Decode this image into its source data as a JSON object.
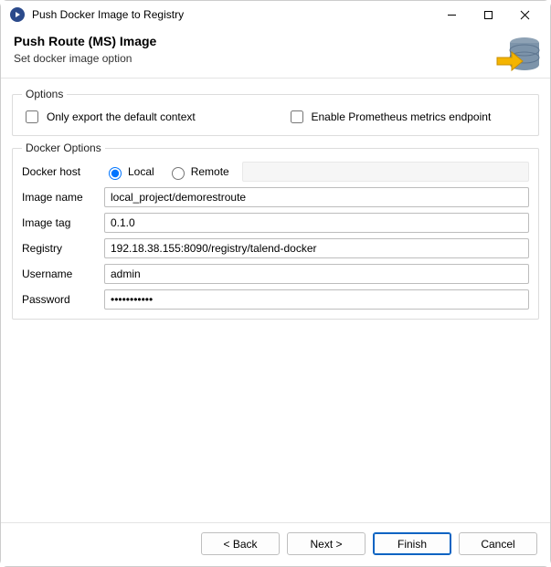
{
  "window": {
    "title": "Push Docker Image to Registry"
  },
  "header": {
    "title": "Push Route (MS) Image",
    "subtitle": "Set docker image option"
  },
  "options": {
    "legend": "Options",
    "only_export_default_context": {
      "label": "Only export the default context",
      "checked": false
    },
    "enable_prometheus": {
      "label": "Enable Prometheus metrics endpoint",
      "checked": false
    }
  },
  "docker": {
    "legend": "Docker Options",
    "host": {
      "label": "Docker host",
      "local_label": "Local",
      "remote_label": "Remote",
      "selected": "local"
    },
    "image_name": {
      "label": "Image name",
      "value": "local_project/demorestroute"
    },
    "image_tag": {
      "label": "Image tag",
      "value": "0.1.0"
    },
    "registry": {
      "label": "Registry",
      "value": "192.18.38.155:8090/registry/talend-docker"
    },
    "username": {
      "label": "Username",
      "value": "admin"
    },
    "password": {
      "label": "Password",
      "value": "•••••••••••",
      "focused": true
    }
  },
  "buttons": {
    "back": "< Back",
    "next": "Next >",
    "finish": "Finish",
    "cancel": "Cancel"
  },
  "icons": {
    "app": "play-circle",
    "banner": "database-arrow"
  }
}
